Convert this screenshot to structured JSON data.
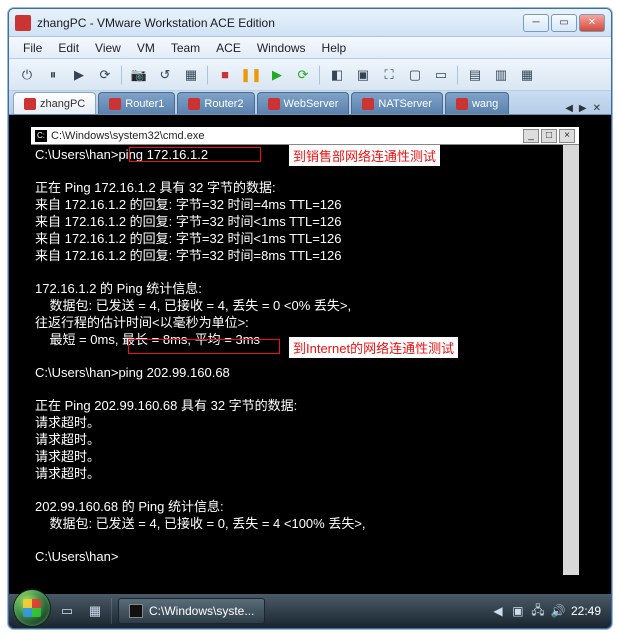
{
  "window": {
    "title": "zhangPC - VMware Workstation ACE Edition"
  },
  "menu": {
    "file": "File",
    "edit": "Edit",
    "view": "View",
    "vm": "VM",
    "team": "Team",
    "ace": "ACE",
    "windows": "Windows",
    "help": "Help"
  },
  "tabs": {
    "t0": "zhangPC",
    "t1": "Router1",
    "t2": "Router2",
    "t3": "WebServer",
    "t4": "NATServer",
    "t5": "wang"
  },
  "cmd": {
    "title": "C:\\Windows\\system32\\cmd.exe",
    "prompt1": "C:\\Users\\han>",
    "cmd1": "ping 172.16.1.2",
    "l1": "正在 Ping 172.16.1.2 具有 32 字节的数据:",
    "l2": "来自 172.16.1.2 的回复: 字节=32 时间=4ms TTL=126",
    "l3": "来自 172.16.1.2 的回复: 字节=32 时间<1ms TTL=126",
    "l4": "来自 172.16.1.2 的回复: 字节=32 时间<1ms TTL=126",
    "l5": "来自 172.16.1.2 的回复: 字节=32 时间=8ms TTL=126",
    "l6": "172.16.1.2 的 Ping 统计信息:",
    "l7": "    数据包: 已发送 = 4, 已接收 = 4, 丢失 = 0 <0% 丢失>,",
    "l8": "往返行程的估计时间<以毫秒为单位>:",
    "l9": "    最短 = 0ms, 最长 = 8ms, 平均 = 3ms",
    "prompt2": "C:\\Users\\han>",
    "cmd2": "ping 202.99.160.68",
    "l10": "正在 Ping 202.99.160.68 具有 32 字节的数据:",
    "l11": "请求超时。",
    "l12": "请求超时。",
    "l13": "请求超时。",
    "l14": "请求超时。",
    "l15": "202.99.160.68 的 Ping 统计信息:",
    "l16": "    数据包: 已发送 = 4, 已接收 = 0, 丢失 = 4 <100% 丢失>,",
    "prompt3": "C:\\Users\\han>"
  },
  "annotations": {
    "a1": "到销售部网络连通性测试",
    "a2": "到Internet的网络连通性测试"
  },
  "taskbar": {
    "appname": "C:\\Windows\\syste...",
    "clock": "22:49"
  }
}
